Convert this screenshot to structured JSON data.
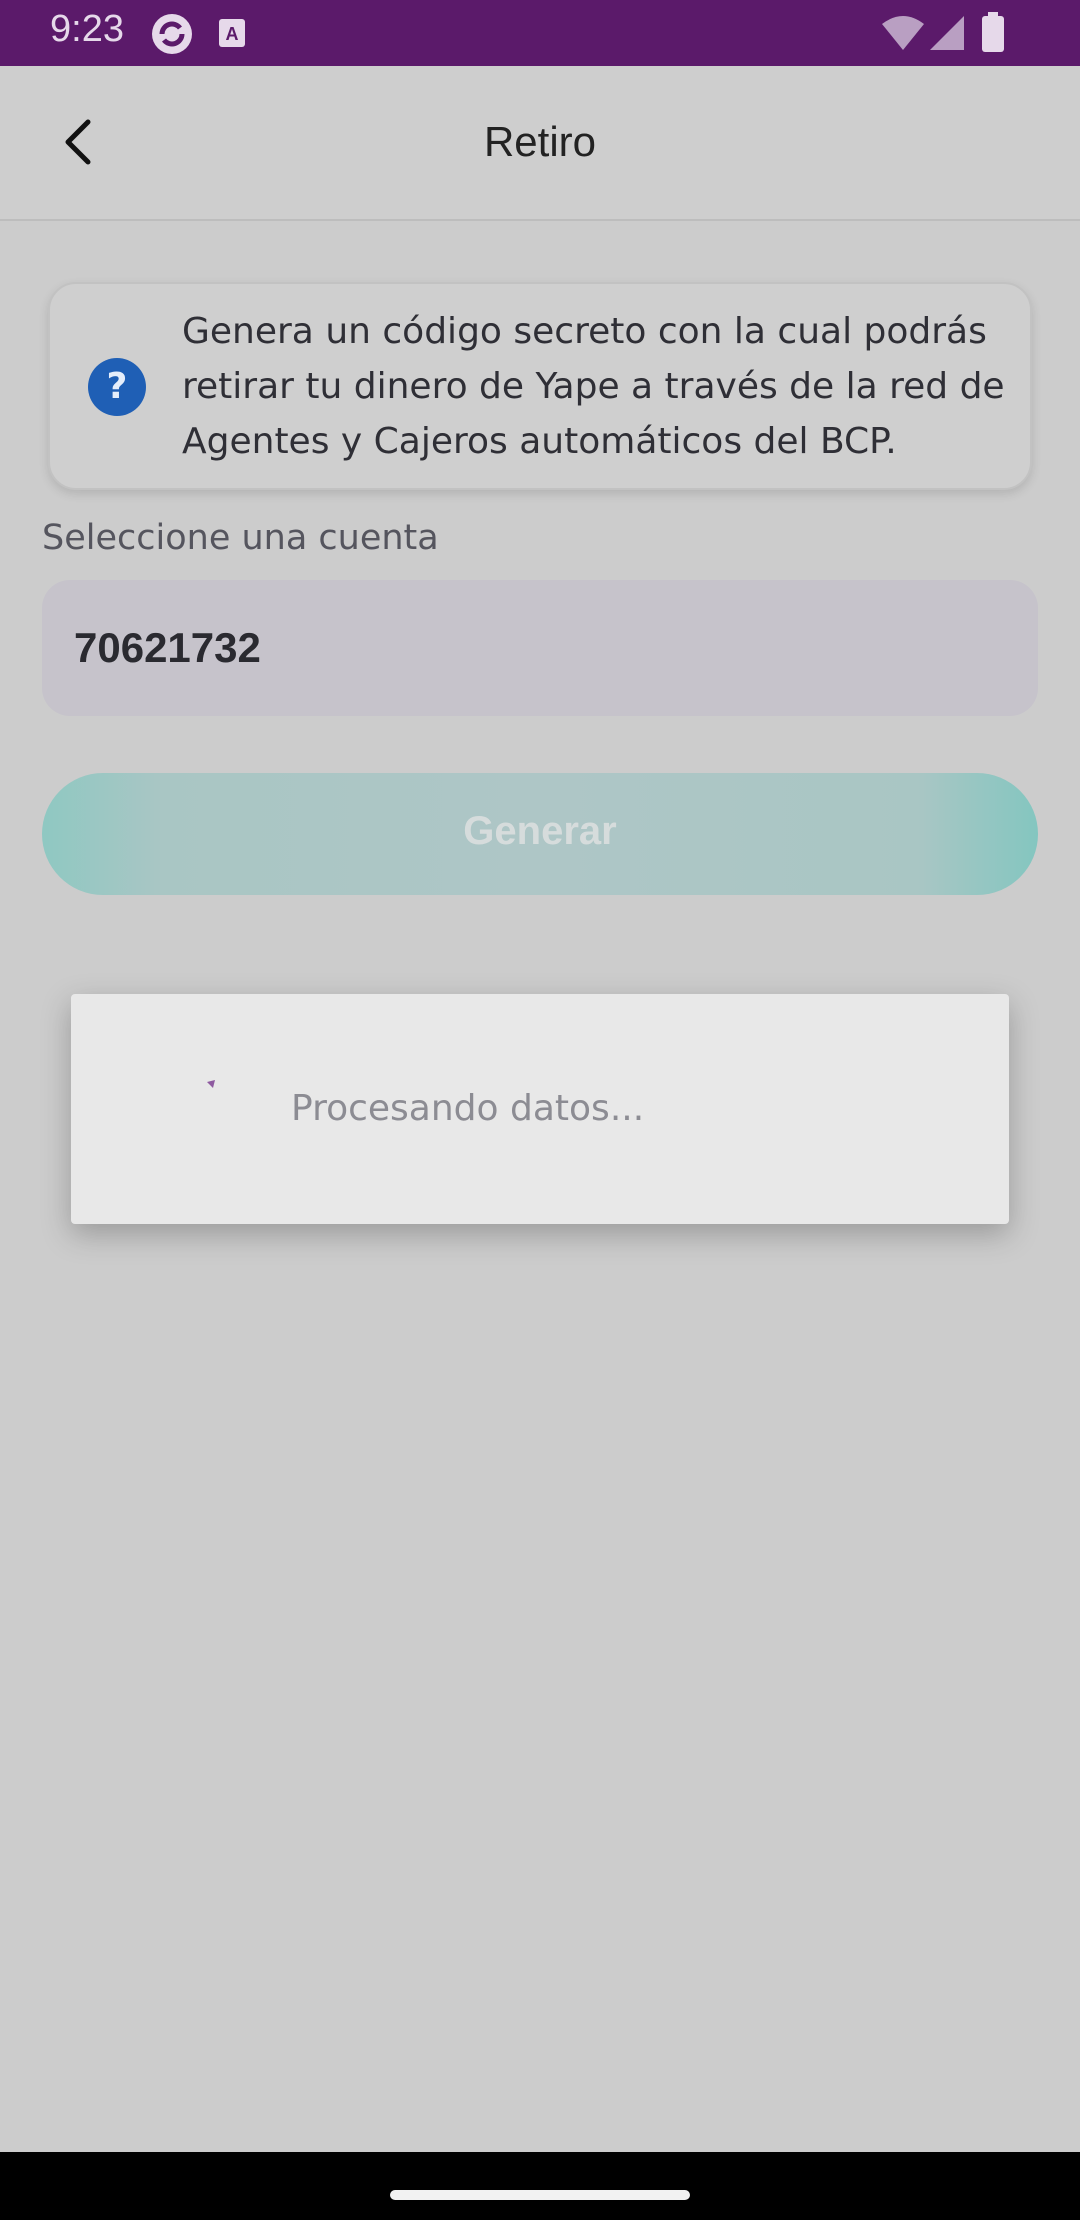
{
  "status_bar": {
    "time": "9:23",
    "icons": [
      "sync-app-icon",
      "keyboard-a-icon",
      "wifi-icon",
      "signal-icon",
      "battery-icon"
    ],
    "bg_color": "#5b1a6a"
  },
  "header": {
    "title": "Retiro",
    "back_icon": "chevron-left-icon"
  },
  "info_card": {
    "icon": "help-icon",
    "icon_glyph": "?",
    "text": "Genera un código secreto con la cual podrás retirar tu dinero de Yape a través de la red de Agentes y Cajeros automáticos del BCP."
  },
  "account": {
    "label": "Seleccione una cuenta",
    "value": "70621732"
  },
  "generate_button": {
    "label": "Generar",
    "color": "#aec6c6"
  },
  "dialog": {
    "text": "Procesando datos...",
    "spinner_icon": "loading-spinner-icon",
    "spinner_color": "#8e5aa0"
  }
}
